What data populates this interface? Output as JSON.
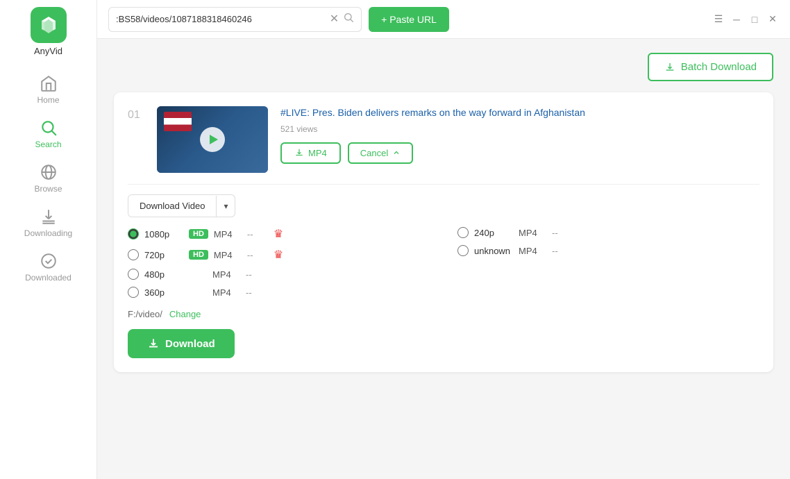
{
  "app": {
    "name": "AnyVid"
  },
  "titlebar": {
    "url_value": ":BS58/videos/1087188318460246",
    "paste_url_label": "+ Paste URL",
    "window_controls": [
      "menu",
      "minimize",
      "maximize",
      "close"
    ]
  },
  "batch_download": {
    "label": "Batch Download"
  },
  "video": {
    "number": "01",
    "title": "#LIVE: Pres. Biden delivers remarks on the way forward in Afghanistan",
    "views": "521 views",
    "mp4_btn": "MP4",
    "cancel_btn": "Cancel"
  },
  "download_options": {
    "type_label": "Download Video",
    "qualities": [
      {
        "id": "q1080",
        "label": "1080p",
        "hd": true,
        "format": "MP4",
        "size": "--",
        "crown": true,
        "selected": true,
        "side": "left"
      },
      {
        "id": "q240",
        "label": "240p",
        "hd": false,
        "format": "MP4",
        "size": "--",
        "crown": false,
        "selected": false,
        "side": "right"
      },
      {
        "id": "q720",
        "label": "720p",
        "hd": true,
        "format": "MP4",
        "size": "--",
        "crown": true,
        "selected": false,
        "side": "left"
      },
      {
        "id": "qunknown",
        "label": "unknown",
        "hd": false,
        "format": "MP4",
        "size": "--",
        "crown": false,
        "selected": false,
        "side": "right"
      },
      {
        "id": "q480",
        "label": "480p",
        "hd": false,
        "format": "MP4",
        "size": "--",
        "crown": false,
        "selected": false,
        "side": "left"
      },
      {
        "id": "q360",
        "label": "360p",
        "hd": false,
        "format": "MP4",
        "size": "--",
        "crown": false,
        "selected": false,
        "side": "left"
      }
    ],
    "path": "F:/video/",
    "change_label": "Change",
    "download_btn": "Download"
  },
  "sidebar": {
    "items": [
      {
        "id": "home",
        "label": "Home",
        "icon": "home"
      },
      {
        "id": "search",
        "label": "Search",
        "icon": "search",
        "active": true
      },
      {
        "id": "browse",
        "label": "Browse",
        "icon": "browse"
      },
      {
        "id": "downloading",
        "label": "Downloading",
        "icon": "downloading"
      },
      {
        "id": "downloaded",
        "label": "Downloaded",
        "icon": "downloaded"
      }
    ]
  }
}
